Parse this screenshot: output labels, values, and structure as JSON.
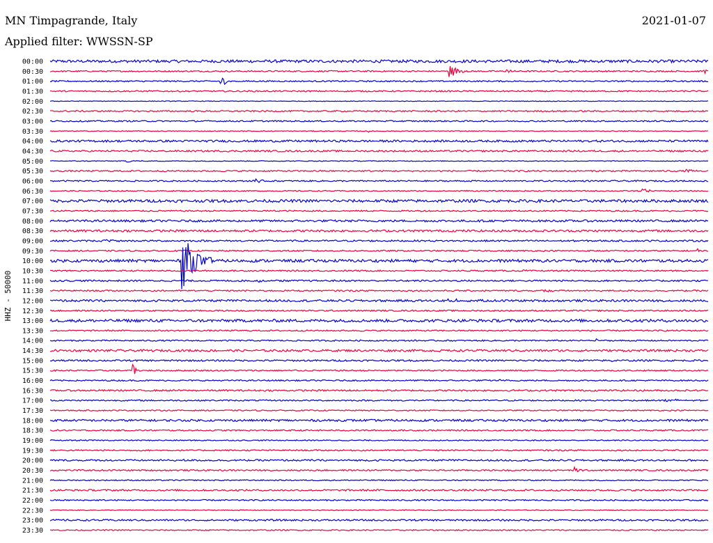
{
  "header": {
    "station": "MN Timpagrande, Italy",
    "date": "2021-01-07",
    "filter": "Applied filter: WWSSN-SP"
  },
  "chart_data": {
    "type": "line",
    "title": "MN Timpagrande, Italy",
    "subtitle": "Applied filter: WWSSN-SP",
    "date": "2021-01-07",
    "ylabel": "HHZ - 50000",
    "xlabel": "",
    "x_unit": "minutes",
    "xlim": [
      0,
      30
    ],
    "ytick_labels": [
      "00:00",
      "00:30",
      "01:00",
      "01:30",
      "02:00",
      "02:30",
      "03:00",
      "03:30",
      "04:00",
      "04:30",
      "05:00",
      "05:30",
      "06:00",
      "06:30",
      "07:00",
      "07:30",
      "08:00",
      "08:30",
      "09:00",
      "09:30",
      "10:00",
      "10:30",
      "11:00",
      "11:30",
      "12:00",
      "12:30",
      "13:00",
      "13:30",
      "14:00",
      "14:30",
      "15:00",
      "15:30",
      "16:00",
      "16:30",
      "17:00",
      "17:30",
      "18:00",
      "18:30",
      "19:00",
      "19:30",
      "20:00",
      "20:30",
      "21:00",
      "21:30",
      "22:00",
      "22:30",
      "23:00",
      "23:30"
    ],
    "grid": false,
    "legend": "none",
    "colors": [
      "#0000cc",
      "#e8003a"
    ],
    "noise_level": [
      2,
      1,
      1,
      1,
      0.5,
      1,
      1,
      0.6,
      1.5,
      1.2,
      0.6,
      1,
      1,
      0.8,
      2,
      1,
      1.5,
      1.5,
      1.2,
      1,
      2,
      1,
      1.2,
      1,
      1.5,
      1,
      2,
      1,
      1,
      1.5,
      1.2,
      1,
      1,
      1.2,
      1,
      0.8,
      1.5,
      1,
      0.8,
      1,
      1.2,
      1,
      0.8,
      1.2,
      1,
      0.6,
      1.2,
      0.8
    ],
    "events": [
      {
        "trace": "00:30",
        "time_min": 18.2,
        "amplitude": 10,
        "duration_min": 1.0
      },
      {
        "trace": "00:30",
        "time_min": 20.8,
        "amplitude": 5,
        "duration_min": 0.4
      },
      {
        "trace": "00:30",
        "time_min": 29.8,
        "amplitude": 3,
        "duration_min": 0.3
      },
      {
        "trace": "01:00",
        "time_min": 7.8,
        "amplitude": 7,
        "duration_min": 0.8
      },
      {
        "trace": "01:30",
        "time_min": 4.5,
        "amplitude": 2,
        "duration_min": 0.4
      },
      {
        "trace": "03:30",
        "time_min": 14.5,
        "amplitude": 2,
        "duration_min": 0.3
      },
      {
        "trace": "05:00",
        "time_min": 3.5,
        "amplitude": 2,
        "duration_min": 1.0
      },
      {
        "trace": "05:30",
        "time_min": 29.0,
        "amplitude": 2,
        "duration_min": 1.0
      },
      {
        "trace": "06:00",
        "time_min": 9.4,
        "amplitude": 6,
        "duration_min": 0.4
      },
      {
        "trace": "06:30",
        "time_min": 27.0,
        "amplitude": 3,
        "duration_min": 1.5
      },
      {
        "trace": "06:30",
        "time_min": 19.0,
        "amplitude": 2,
        "duration_min": 0.4
      },
      {
        "trace": "09:00",
        "time_min": 2.5,
        "amplitude": 3,
        "duration_min": 0.8
      },
      {
        "trace": "09:30",
        "time_min": 29.5,
        "amplitude": 5,
        "duration_min": 0.3
      },
      {
        "trace": "10:00",
        "time_min": 6.0,
        "amplitude": 42,
        "duration_min": 1.6
      },
      {
        "trace": "10:30",
        "time_min": 21.5,
        "amplitude": 2,
        "duration_min": 0.3
      },
      {
        "trace": "11:00",
        "time_min": 9.5,
        "amplitude": 2,
        "duration_min": 1.0
      },
      {
        "trace": "11:00",
        "time_min": 28.2,
        "amplitude": 2,
        "duration_min": 0.3
      },
      {
        "trace": "11:30",
        "time_min": 22.5,
        "amplitude": 2,
        "duration_min": 1.0
      },
      {
        "trace": "12:00",
        "time_min": 18.0,
        "amplitude": 3,
        "duration_min": 2.0
      },
      {
        "trace": "14:00",
        "time_min": 24.9,
        "amplitude": 3,
        "duration_min": 0.3
      },
      {
        "trace": "14:30",
        "time_min": 17.5,
        "amplitude": 2,
        "duration_min": 1.0
      },
      {
        "trace": "15:00",
        "time_min": 25.5,
        "amplitude": 3,
        "duration_min": 0.5
      },
      {
        "trace": "15:30",
        "time_min": 3.8,
        "amplitude": 9,
        "duration_min": 0.4
      },
      {
        "trace": "15:30",
        "time_min": 11.0,
        "amplitude": 3,
        "duration_min": 0.4
      },
      {
        "trace": "16:00",
        "time_min": 20.5,
        "amplitude": 2,
        "duration_min": 0.5
      },
      {
        "trace": "17:00",
        "time_min": 28.0,
        "amplitude": 3,
        "duration_min": 1.5
      },
      {
        "trace": "20:00",
        "time_min": 6.0,
        "amplitude": 2,
        "duration_min": 0.5
      },
      {
        "trace": "20:30",
        "time_min": 23.9,
        "amplitude": 5,
        "duration_min": 0.5
      }
    ]
  }
}
